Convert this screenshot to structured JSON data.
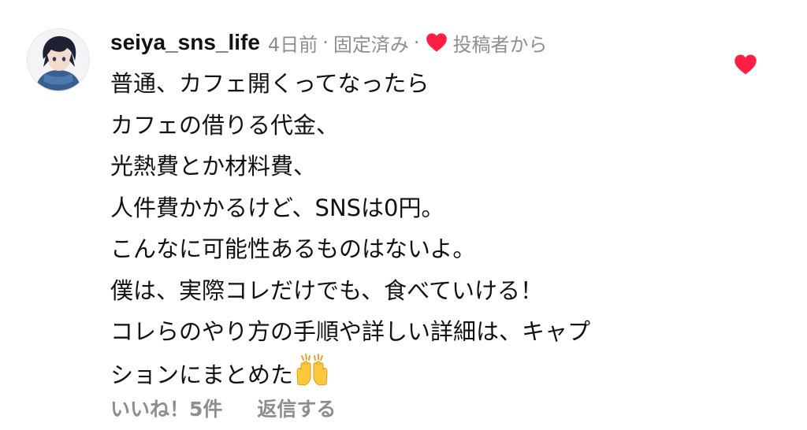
{
  "comment": {
    "avatar_icon": "user-avatar-anime-boy",
    "username": "seiya_sns_life",
    "time_ago": "4日前",
    "separator": "·",
    "pinned_label": "固定済み",
    "author_liked_icon": "heart-icon",
    "author_liked_label": "投稿者から",
    "body_lines": [
      "普通、カフェ開くってなったら",
      "カフェの借りる代金、",
      "光熱費とか材料費、",
      "人件費かかるけど、SNSは0円。",
      "こんなに可能性あるものはないよ。",
      "僕は、実際コレだけでも、食べていける！",
      "コレらのやり方の手順や詳しい詳細は、キャプ",
      "ションにまとめた"
    ],
    "body_emoji": "raising-hands-emoji",
    "likes_label": "いいね！5件",
    "reply_label": "返信する",
    "like_button_icon": "heart-icon"
  },
  "colors": {
    "heart": "#ff1f44",
    "meta_gray": "#8e8e8e",
    "text": "#111111"
  }
}
